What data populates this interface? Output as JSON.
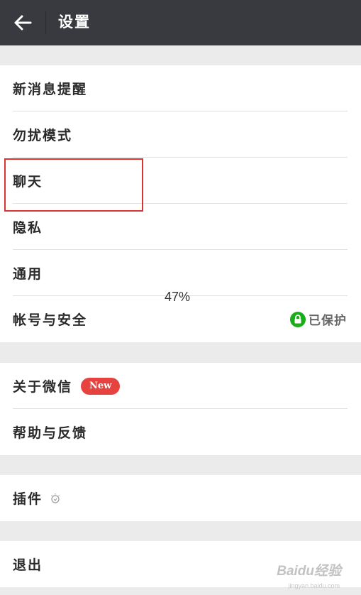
{
  "header": {
    "title": "设置",
    "back_icon": "arrow-left-icon"
  },
  "groups": [
    {
      "items": [
        {
          "label": "新消息提醒"
        },
        {
          "label": "勿扰模式"
        },
        {
          "label": "聊天"
        },
        {
          "label": "隐私"
        },
        {
          "label": "通用"
        },
        {
          "label": "帐号与安全",
          "status": "已保护",
          "status_icon": "lock-icon"
        }
      ]
    },
    {
      "items": [
        {
          "label": "关于微信",
          "badge": "New"
        },
        {
          "label": "帮助与反馈"
        }
      ]
    },
    {
      "items": [
        {
          "label": "插件",
          "icon": "plugin-bulb-icon"
        }
      ]
    },
    {
      "items": [
        {
          "label": "退出"
        }
      ]
    }
  ],
  "overlay": {
    "percent": "47%"
  },
  "watermark": {
    "text": "Baidu经验",
    "url": "jingyan.baidu.com"
  },
  "colors": {
    "topbar": "#393a3f",
    "background": "#ebebeb",
    "badge": "#e64340",
    "lock": "#1aad19",
    "highlight": "#d93434"
  }
}
